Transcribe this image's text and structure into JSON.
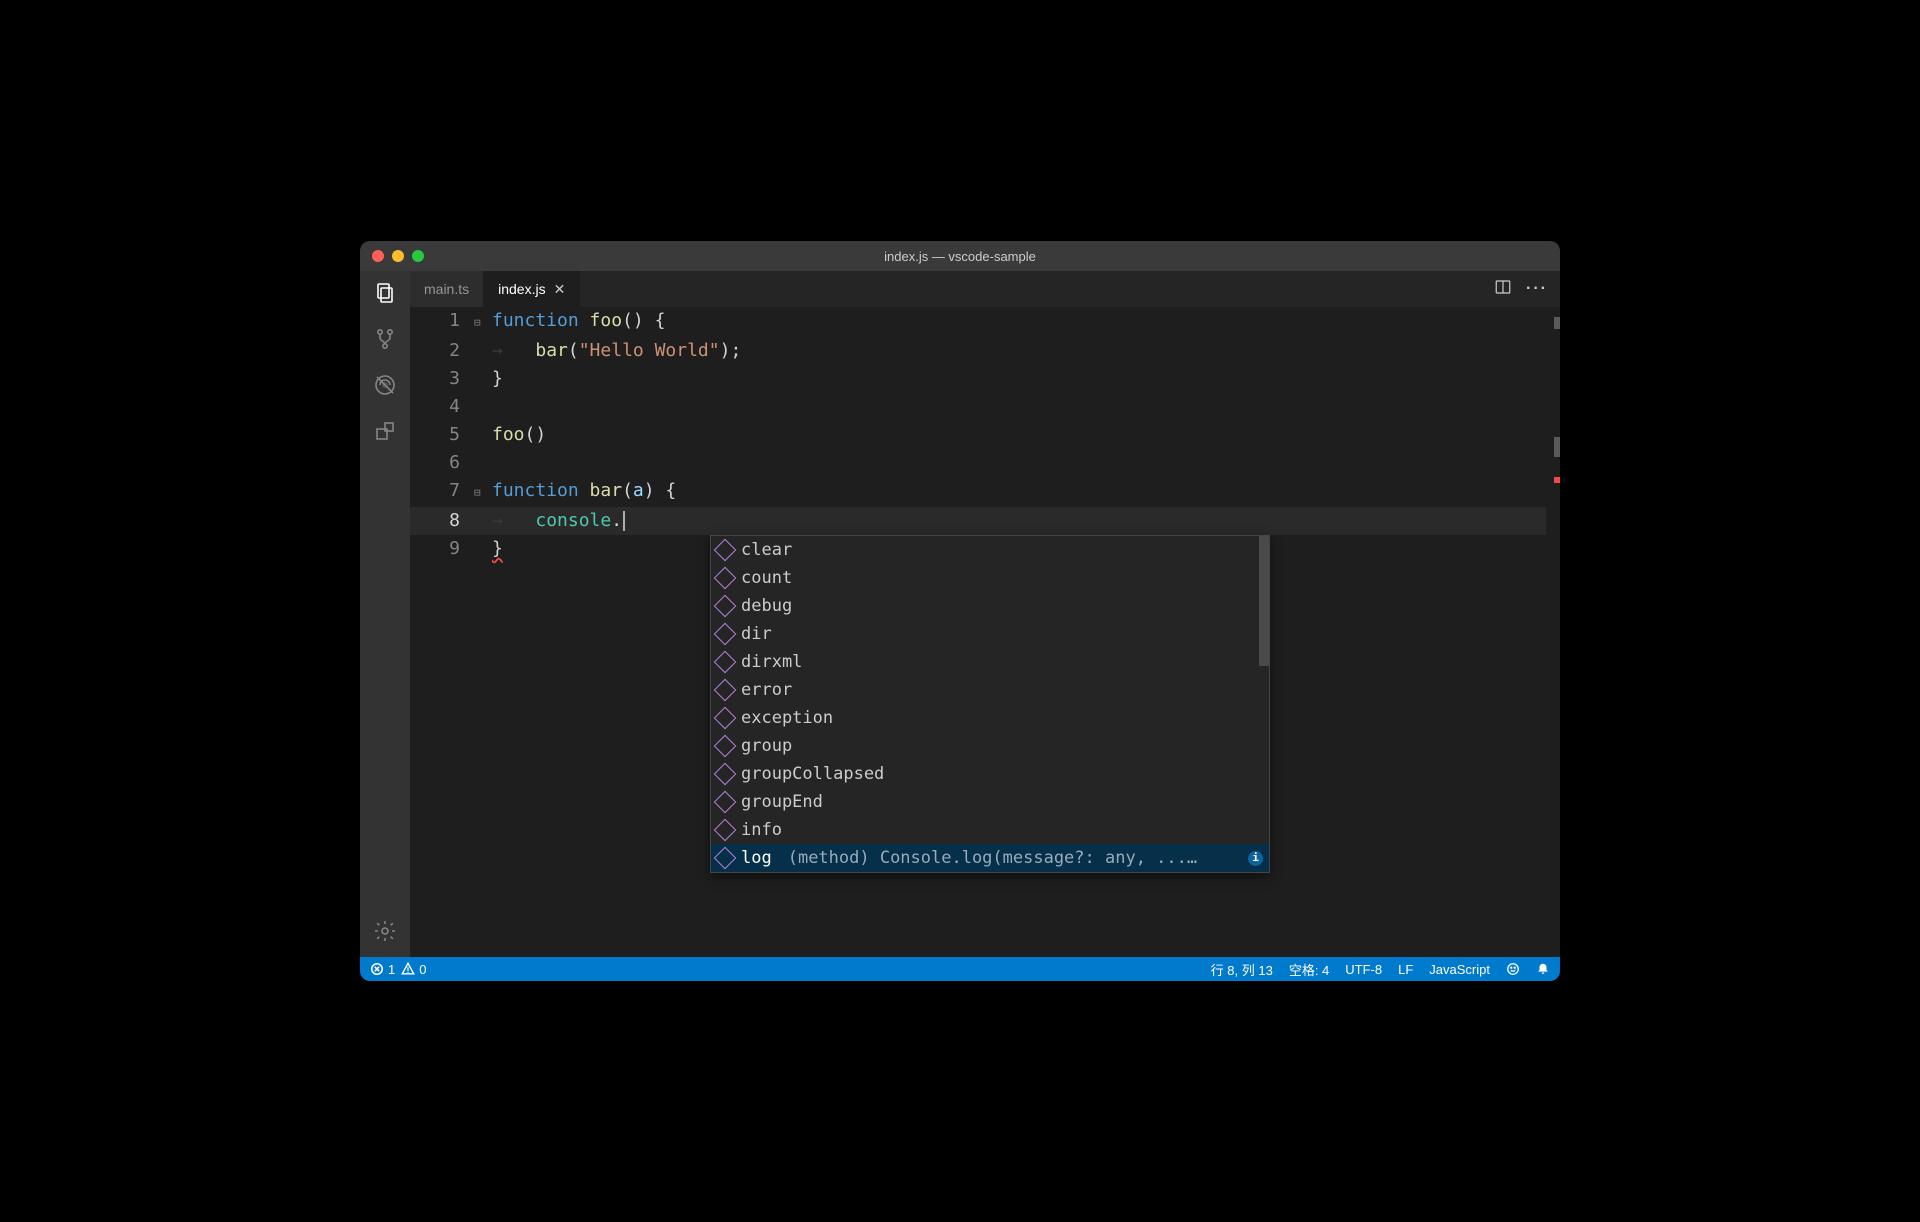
{
  "window_title": "index.js — vscode-sample",
  "tabs": [
    {
      "label": "main.ts",
      "active": false
    },
    {
      "label": "index.js",
      "active": true
    }
  ],
  "code": {
    "lines": [
      {
        "n": "1",
        "fold": "⊟",
        "tokens": [
          [
            "kw",
            "function"
          ],
          [
            "pl",
            " "
          ],
          [
            "fn",
            "foo"
          ],
          [
            "pl",
            "() {"
          ]
        ]
      },
      {
        "n": "2",
        "fold": "",
        "indent": 1,
        "tokens": [
          [
            "fn",
            "bar"
          ],
          [
            "pl",
            "("
          ],
          [
            "str",
            "\"Hello World\""
          ],
          [
            "pl",
            ");"
          ]
        ]
      },
      {
        "n": "3",
        "fold": "",
        "tokens": [
          [
            "pl",
            "}"
          ]
        ]
      },
      {
        "n": "4",
        "fold": "",
        "tokens": []
      },
      {
        "n": "5",
        "fold": "",
        "tokens": [
          [
            "fn",
            "foo"
          ],
          [
            "pl",
            "()"
          ]
        ]
      },
      {
        "n": "6",
        "fold": "",
        "tokens": []
      },
      {
        "n": "7",
        "fold": "⊟",
        "tokens": [
          [
            "kw",
            "function"
          ],
          [
            "pl",
            " "
          ],
          [
            "fn",
            "bar"
          ],
          [
            "pl",
            "("
          ],
          [
            "prop",
            "a"
          ],
          [
            "pl",
            ") {"
          ]
        ]
      },
      {
        "n": "8",
        "fold": "",
        "indent": 1,
        "current": true,
        "tokens": [
          [
            "id",
            "console"
          ],
          [
            "pl",
            "."
          ]
        ],
        "cursor": true
      },
      {
        "n": "9",
        "fold": "",
        "tokens": [
          [
            "pl squiggle",
            "}"
          ]
        ]
      }
    ]
  },
  "suggestions": [
    {
      "label": "clear"
    },
    {
      "label": "count"
    },
    {
      "label": "debug"
    },
    {
      "label": "dir"
    },
    {
      "label": "dirxml"
    },
    {
      "label": "error"
    },
    {
      "label": "exception"
    },
    {
      "label": "group"
    },
    {
      "label": "groupCollapsed"
    },
    {
      "label": "groupEnd"
    },
    {
      "label": "info"
    },
    {
      "label": "log",
      "selected": true,
      "doc": "(method) Console.log(message?: any, ...…"
    }
  ],
  "status": {
    "errors": "1",
    "warnings": "0",
    "line_col": "行 8, 列 13",
    "spaces": "空格: 4",
    "encoding": "UTF-8",
    "eol": "LF",
    "language": "JavaScript"
  }
}
